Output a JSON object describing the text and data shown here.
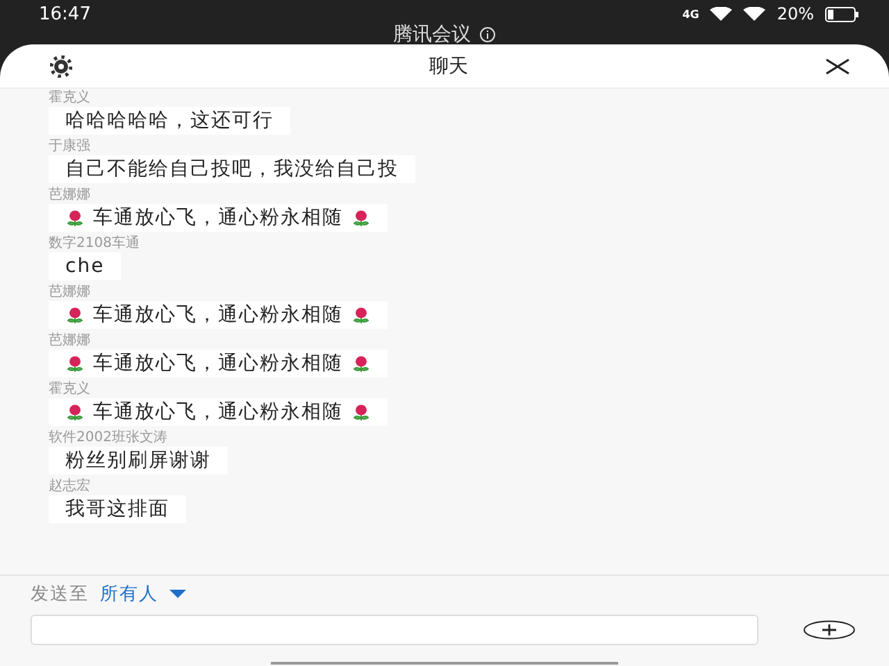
{
  "status_bar": {
    "time": "16:47",
    "network": "4G",
    "battery": "20%"
  },
  "meeting_bar": {
    "title": "腾讯会议"
  },
  "chat": {
    "title": "聊天",
    "messages": [
      {
        "sender": "霍克义",
        "kind": "text",
        "text": "哈哈哈哈哈，这还可行"
      },
      {
        "sender": "于康强",
        "kind": "text",
        "text": "自己不能给自己投吧，我没给自己投"
      },
      {
        "sender": "芭娜娜",
        "kind": "flowers",
        "text": "车通放心飞，通心粉永相随"
      },
      {
        "sender": "数字2108车通",
        "kind": "text",
        "text": "che"
      },
      {
        "sender": "芭娜娜",
        "kind": "flowers",
        "text": "车通放心飞，通心粉永相随"
      },
      {
        "sender": "芭娜娜",
        "kind": "flowers",
        "text": "车通放心飞，通心粉永相随"
      },
      {
        "sender": "霍克义",
        "kind": "flowers",
        "text": "车通放心飞，通心粉永相随"
      },
      {
        "sender": "软件2002班张文涛",
        "kind": "text",
        "text": "粉丝别刷屏谢谢"
      },
      {
        "sender": "赵志宏",
        "kind": "text",
        "text": "我哥这排面"
      }
    ],
    "send_to": {
      "label": "发送至",
      "recipient": "所有人"
    }
  }
}
